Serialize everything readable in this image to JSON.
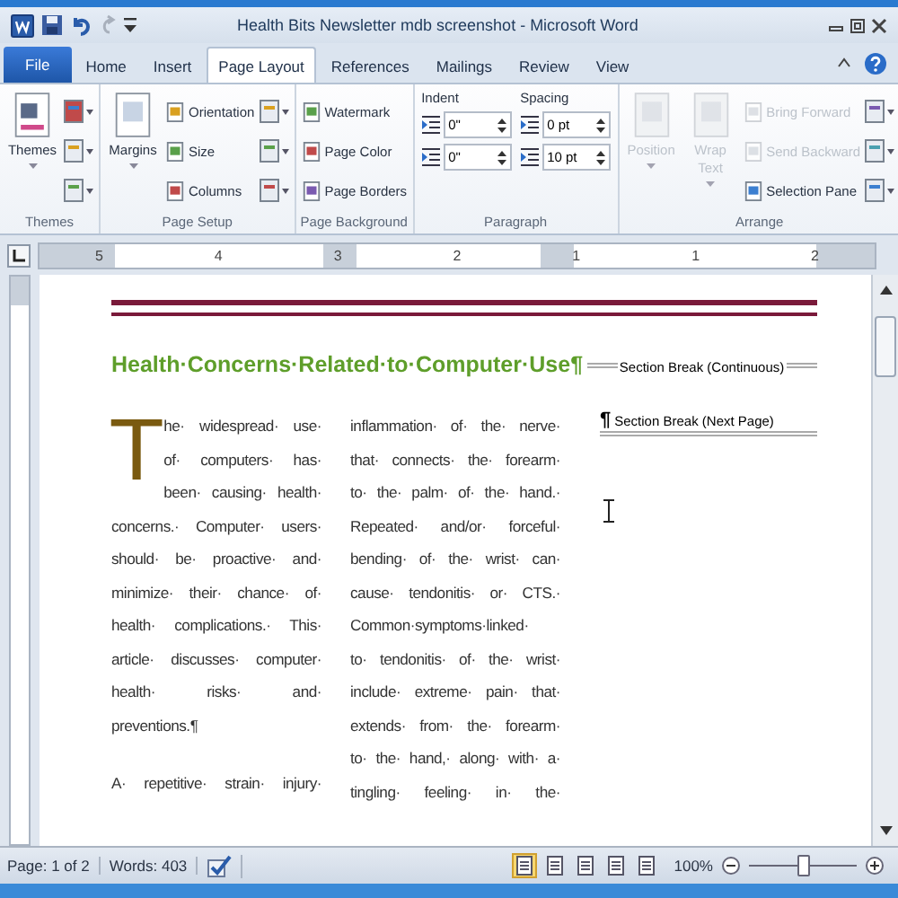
{
  "window": {
    "title": "Health Bits Newsletter mdb screenshot  -  Microsoft Word"
  },
  "tabs": [
    {
      "label": "File",
      "kind": "file",
      "selected": false
    },
    {
      "label": "Home",
      "kind": "tab",
      "selected": false
    },
    {
      "label": "Insert",
      "kind": "tab",
      "selected": false
    },
    {
      "label": "Page Layout",
      "kind": "tab",
      "selected": true
    },
    {
      "label": "References",
      "kind": "tab",
      "selected": false
    },
    {
      "label": "Mailings",
      "kind": "tab",
      "selected": false
    },
    {
      "label": "Review",
      "kind": "tab",
      "selected": false
    },
    {
      "label": "View",
      "kind": "tab",
      "selected": false
    }
  ],
  "ribbon": [
    {
      "label": "Themes",
      "columns": [
        {
          "kind": "large",
          "label": "Themes",
          "disabled": false
        },
        {
          "kind": "icons"
        }
      ]
    },
    {
      "label": "Page Setup",
      "columns": [
        {
          "kind": "large",
          "label": "Margins",
          "disabled": false
        },
        {
          "kind": "stack",
          "items": [
            {
              "label": "Orientation",
              "disabled": false
            },
            {
              "label": "Size",
              "disabled": false
            },
            {
              "label": "Columns",
              "disabled": false
            }
          ]
        },
        {
          "kind": "icons"
        }
      ]
    },
    {
      "label": "Page Background",
      "columns": [
        {
          "kind": "stack",
          "items": [
            {
              "label": "Watermark",
              "disabled": false
            },
            {
              "label": "Page Color",
              "disabled": false
            },
            {
              "label": "Page Borders",
              "disabled": false
            }
          ]
        }
      ]
    },
    {
      "label": "Paragraph",
      "columns": [
        {
          "kind": "fields",
          "heading": "Indent",
          "fields": [
            {
              "value": "0\""
            },
            {
              "value": "0\""
            }
          ]
        },
        {
          "kind": "fields",
          "heading": "Spacing",
          "fields": [
            {
              "value": "0 pt"
            },
            {
              "value": "10 pt"
            }
          ]
        }
      ]
    },
    {
      "label": "Arrange",
      "columns": [
        {
          "kind": "large",
          "label": "Position",
          "disabled": true
        },
        {
          "kind": "large",
          "label": "Wrap Text",
          "disabled": true
        },
        {
          "kind": "stack",
          "items": [
            {
              "label": "Bring Forward",
              "disabled": true
            },
            {
              "label": "Send Backward",
              "disabled": true
            },
            {
              "label": "Selection Pane",
              "disabled": false
            }
          ]
        },
        {
          "kind": "icons"
        }
      ]
    }
  ],
  "ruler": {
    "marks": [
      "5",
      "4",
      "3",
      "2",
      "1",
      "1",
      "2"
    ]
  },
  "document": {
    "heading": "Health·Concerns·Related·to·Computer·Use¶",
    "section_breaks": [
      {
        "label": "Section Break (Continuous)"
      },
      {
        "mark": "¶",
        "label": "Section Break (Next Page)"
      }
    ],
    "columns": [
      [
        {
          "drop_cap": "T",
          "lines": [
            "he· widespread· use·",
            "of· computers· has·",
            "been· causing· health·",
            "concerns.· Computer· users·",
            "should· be· proactive· and·",
            "minimize· their· chance· of·",
            "health· complications.· This·",
            "article· discusses· computer·",
            "health·  risks·  and·",
            "preventions.¶"
          ]
        },
        {
          "lines": [
            "A· repetitive· strain· injury·"
          ]
        }
      ],
      [
        {
          "lines": [
            "inflammation· of· the· nerve·",
            "that· connects· the· forearm·",
            "to· the· palm· of· the· hand.·",
            "Repeated· and/or· forceful·",
            "bending· of· the· wrist· can·",
            "cause· tendonitis· or· CTS.·",
            "Common·symptoms·linked·",
            "to· tendonitis· of· the· wrist·",
            "include· extreme· pain· that·",
            "extends· from· the· forearm·",
            "to· the· hand,· along· with· a·",
            "tingling· feeling· in· the·"
          ]
        }
      ]
    ]
  },
  "status_bar": {
    "page": "Page: 1 of 2",
    "words": "Words: 403",
    "views": [
      {
        "selected": true
      },
      {
        "selected": false
      },
      {
        "selected": false
      },
      {
        "selected": false
      },
      {
        "selected": false
      }
    ],
    "zoom": "100%",
    "zoom_level": {
      "level": 0.5
    }
  }
}
